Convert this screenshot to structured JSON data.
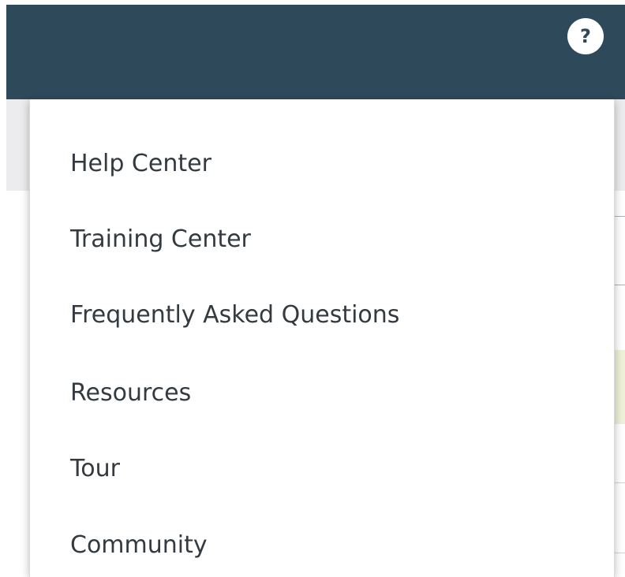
{
  "header": {
    "help_button_label": "?",
    "help_icon": "question-mark-icon"
  },
  "help_menu": {
    "items": [
      {
        "label": "Help Center"
      },
      {
        "label": "Training Center"
      },
      {
        "label": "Frequently Asked Questions"
      },
      {
        "label": "Resources"
      },
      {
        "label": "Tour"
      },
      {
        "label": "Community"
      }
    ]
  },
  "colors": {
    "header_background": "#2e4a5a",
    "menu_text": "#333a40",
    "menu_background": "#ffffff"
  }
}
